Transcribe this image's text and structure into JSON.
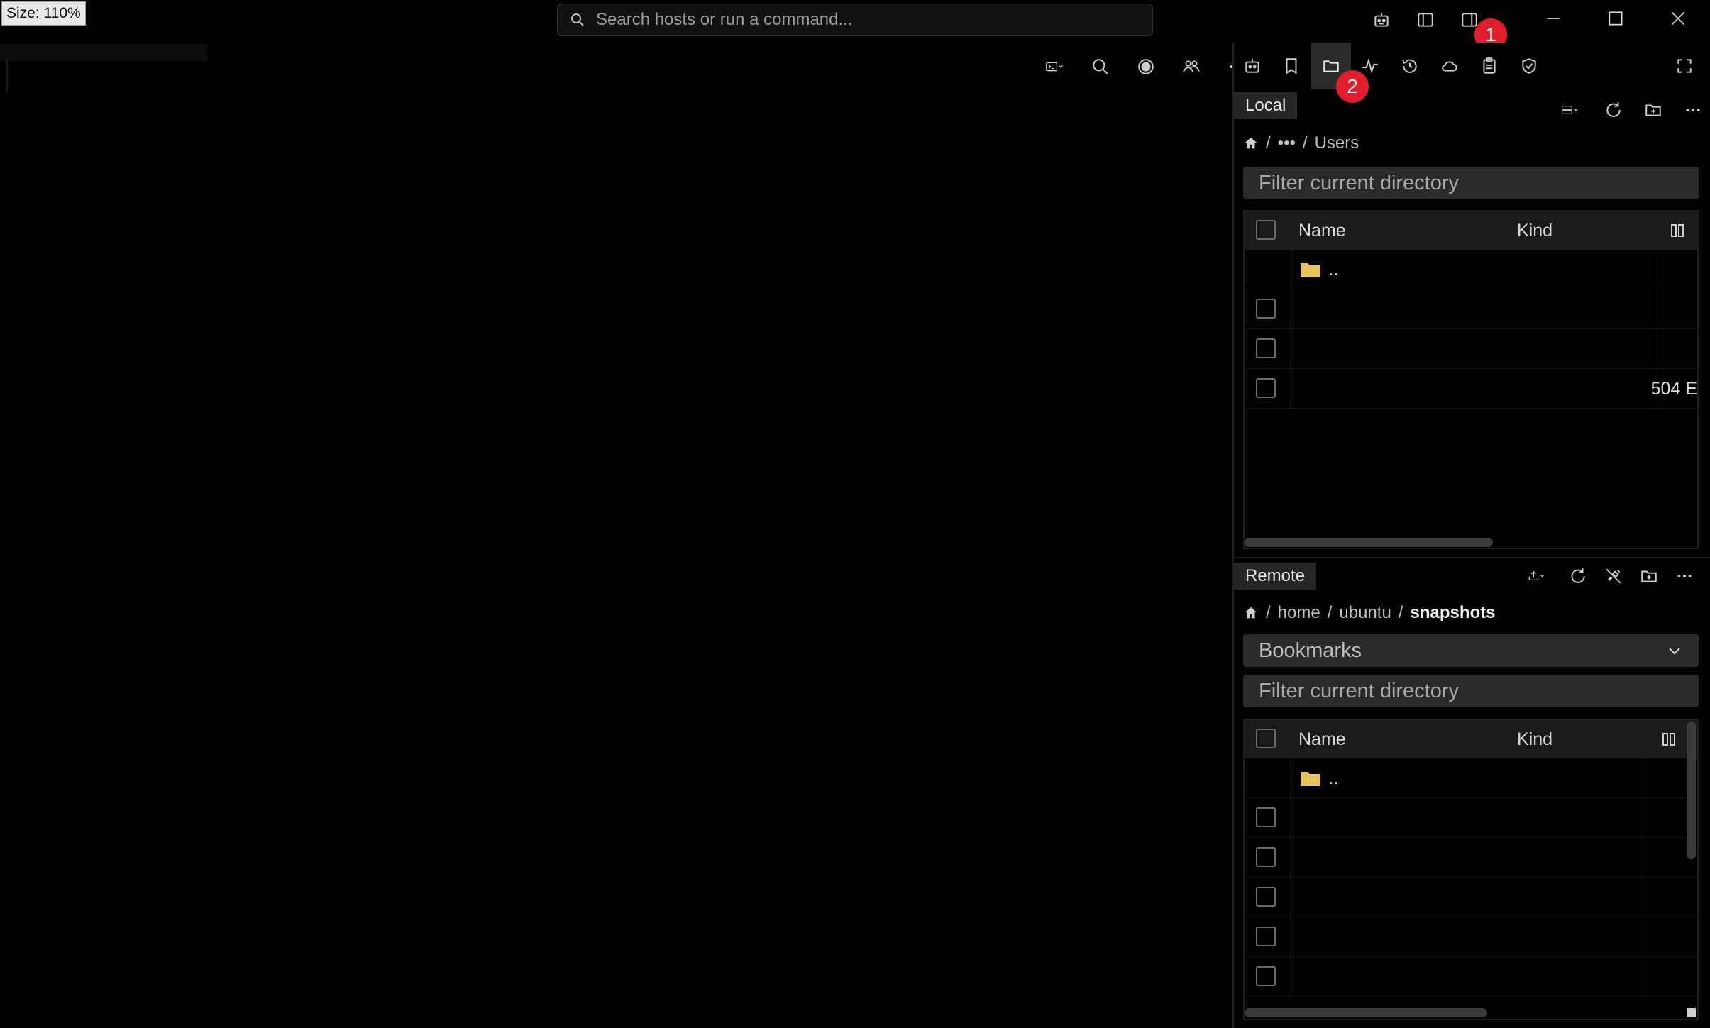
{
  "size_badge": "Size: 110%",
  "search": {
    "placeholder": "Search hosts or run a command..."
  },
  "annotations": {
    "badge1": "1",
    "badge2": "2"
  },
  "local": {
    "tab_label": "Local",
    "breadcrumb": {
      "ellipsis": "•••",
      "current": "Users",
      "sep": "/"
    },
    "filter_placeholder": "Filter current directory",
    "columns": {
      "name": "Name",
      "kind": "Kind"
    },
    "rows": [
      {
        "name": "..",
        "type": "folder",
        "size": ""
      },
      {
        "name": "",
        "type": "file",
        "size": ""
      },
      {
        "name": "",
        "type": "file",
        "size": ""
      },
      {
        "name": "",
        "type": "file",
        "size": "504 E"
      }
    ]
  },
  "remote": {
    "tab_label": "Remote",
    "breadcrumb": {
      "home": "home",
      "user": "ubuntu",
      "current": "snapshots",
      "sep": "/"
    },
    "bookmarks_label": "Bookmarks",
    "filter_placeholder": "Filter current directory",
    "columns": {
      "name": "Name",
      "kind": "Kind"
    },
    "rows": [
      {
        "name": "..",
        "type": "folder"
      },
      {
        "name": "",
        "type": "file"
      },
      {
        "name": "",
        "type": "file"
      },
      {
        "name": "",
        "type": "file"
      },
      {
        "name": "",
        "type": "file"
      },
      {
        "name": "",
        "type": "file"
      }
    ]
  },
  "colors": {
    "accent_badge": "#e11d2b",
    "folder": "#e6c45a",
    "background": "#000000",
    "panel_tab": "#262626"
  }
}
